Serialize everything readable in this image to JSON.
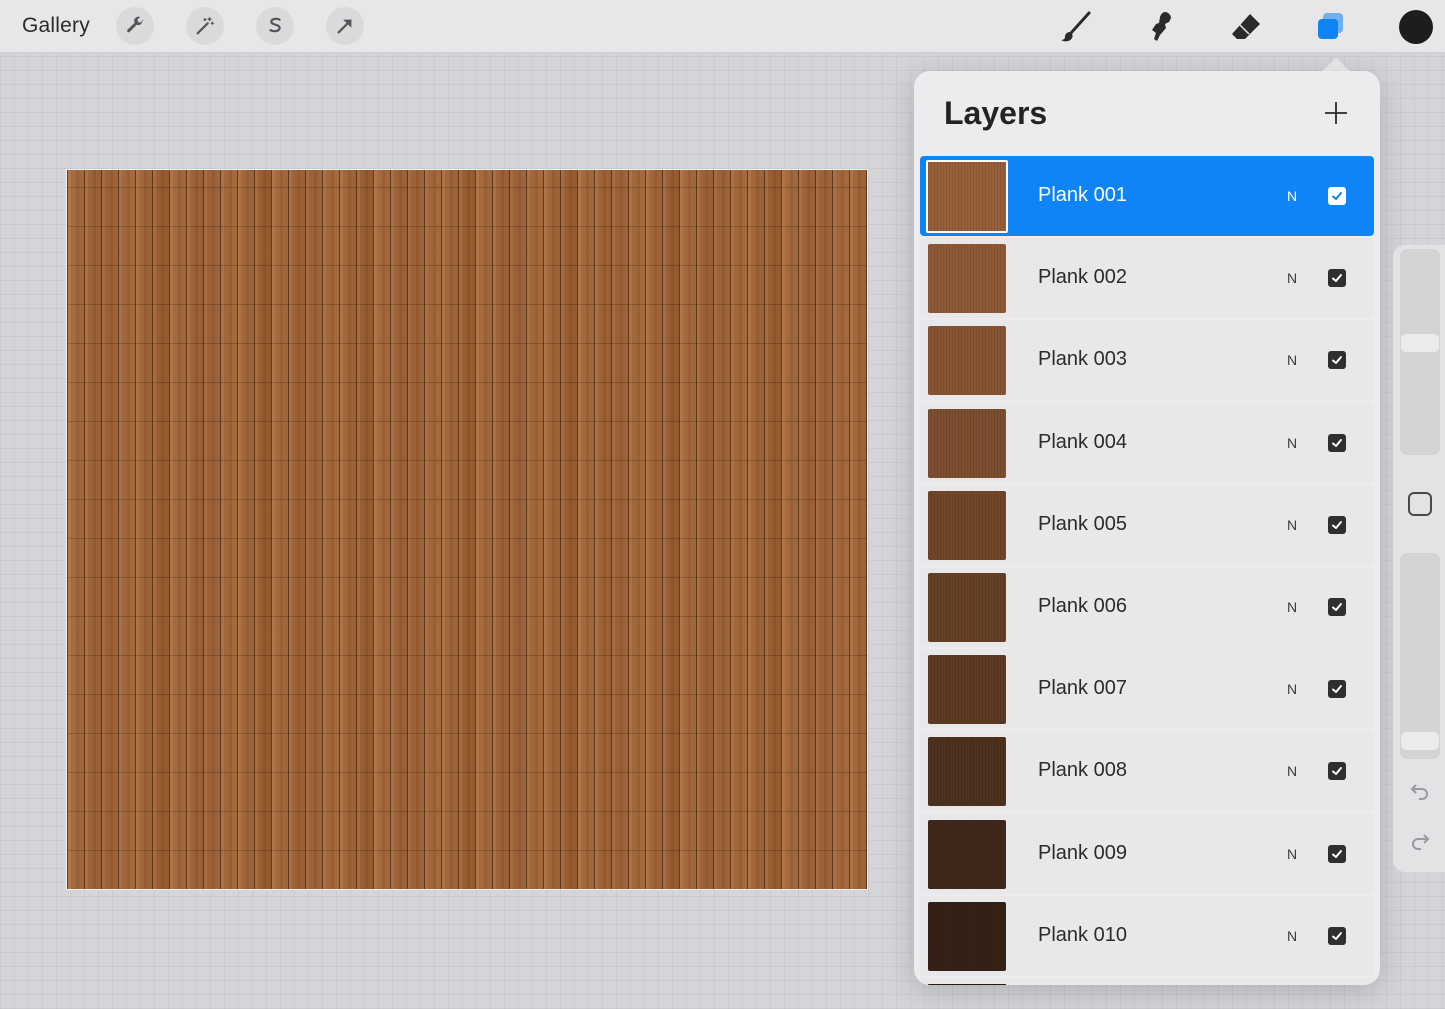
{
  "toolbar": {
    "gallery_label": "Gallery",
    "left_tools": [
      "wrench-icon",
      "magic-wand-icon",
      "selection-s-icon",
      "transform-arrow-icon"
    ],
    "right_tools": [
      "brush-icon",
      "smudge-icon",
      "eraser-icon",
      "layers-icon"
    ],
    "active_tool": "layers-icon",
    "accent_color": "#0f84f7",
    "current_color": "#1d1d1f"
  },
  "layers_panel": {
    "title": "Layers",
    "add_icon": "plus-icon",
    "layers": [
      {
        "name": "Plank 001",
        "blend": "N",
        "visible": true,
        "selected": true,
        "thumb_color": "#98603a"
      },
      {
        "name": "Plank 002",
        "blend": "N",
        "visible": true,
        "selected": false,
        "thumb_color": "#8e5a35"
      },
      {
        "name": "Plank 003",
        "blend": "N",
        "visible": true,
        "selected": false,
        "thumb_color": "#875532"
      },
      {
        "name": "Plank 004",
        "blend": "N",
        "visible": true,
        "selected": false,
        "thumb_color": "#7d4e2f"
      },
      {
        "name": "Plank 005",
        "blend": "N",
        "visible": true,
        "selected": false,
        "thumb_color": "#714629"
      },
      {
        "name": "Plank 006",
        "blend": "N",
        "visible": true,
        "selected": false,
        "thumb_color": "#654027"
      },
      {
        "name": "Plank 007",
        "blend": "N",
        "visible": true,
        "selected": false,
        "thumb_color": "#5c3a23"
      },
      {
        "name": "Plank 008",
        "blend": "N",
        "visible": true,
        "selected": false,
        "thumb_color": "#4e311e"
      },
      {
        "name": "Plank 009",
        "blend": "N",
        "visible": true,
        "selected": false,
        "thumb_color": "#40291a"
      },
      {
        "name": "Plank 010",
        "blend": "N",
        "visible": true,
        "selected": false,
        "thumb_color": "#352217"
      }
    ]
  },
  "sidebar": {
    "brush_size_level": 0.55,
    "opacity_level": 0.95,
    "modify_icon": "square-modify-icon",
    "undo_icon": "undo-icon",
    "redo_icon": "redo-icon"
  }
}
